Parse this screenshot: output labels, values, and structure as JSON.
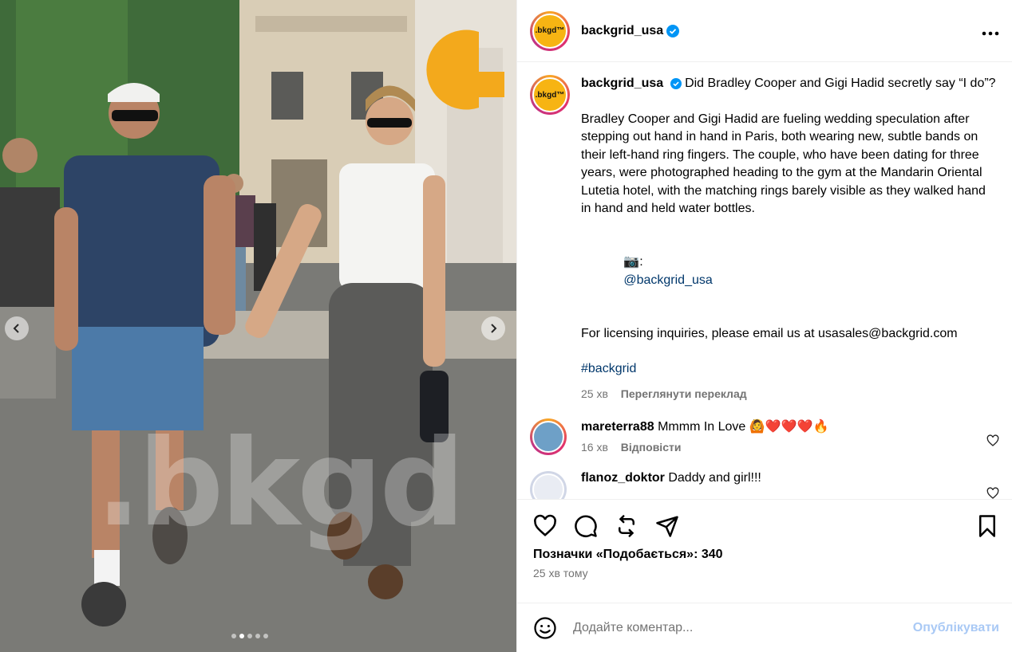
{
  "colors": {
    "accent": "#0095f6",
    "brand_avatar": "#f7b413",
    "muted": "#737373",
    "link": "#00376b"
  },
  "media": {
    "watermark": ".bkgd",
    "nav_prev_icon": "chevron-left-icon",
    "nav_next_icon": "chevron-right-icon",
    "carousel_total": 5,
    "carousel_active": 2
  },
  "header": {
    "username": "backgrid_usa",
    "avatar_text": ".bkgd™",
    "more_icon": "more-horizontal-icon"
  },
  "caption": {
    "username": "backgrid_usa",
    "avatar_text": ".bkgd™",
    "headline": "Did Bradley Cooper and Gigi Hadid secretly say “I do”?",
    "body": "Bradley Cooper and Gigi Hadid are fueling wedding speculation after stepping out hand in hand in Paris, both wearing new, subtle bands on their left-hand ring fingers. The couple, who have been dating for three years, were photographed heading to the gym at the Mandarin Oriental Lutetia hotel, with the matching rings barely visible as they walked hand in hand and held water bottles.",
    "photo_credit_emoji": "📷:",
    "photo_credit_link": "@backgrid_usa",
    "licensing": "For licensing inquiries, please email us at usasales@backgrid.com",
    "hashtag": "#backgrid",
    "time": "25 хв",
    "translate": "Переглянути переклад"
  },
  "comments": [
    {
      "username": "mareterra88",
      "text": "Mmmm In Love 🙆❤️❤️❤️🔥",
      "time": "16 хв",
      "reply": "Відповісти"
    },
    {
      "username": "flanoz_doktor",
      "text": "Daddy and girl!!!",
      "time": "",
      "reply": ""
    }
  ],
  "actions": {
    "like_icon": "heart-icon",
    "comment_icon": "comment-icon",
    "repost_icon": "repost-icon",
    "share_icon": "send-icon",
    "save_icon": "bookmark-icon",
    "likes_text": "Позначки «Подобається»: 340",
    "time_ago": "25 хв тому"
  },
  "add_comment": {
    "placeholder": "Додайте коментар...",
    "publish_label": "Опублікувати",
    "emoji_icon": "smiley-icon"
  }
}
